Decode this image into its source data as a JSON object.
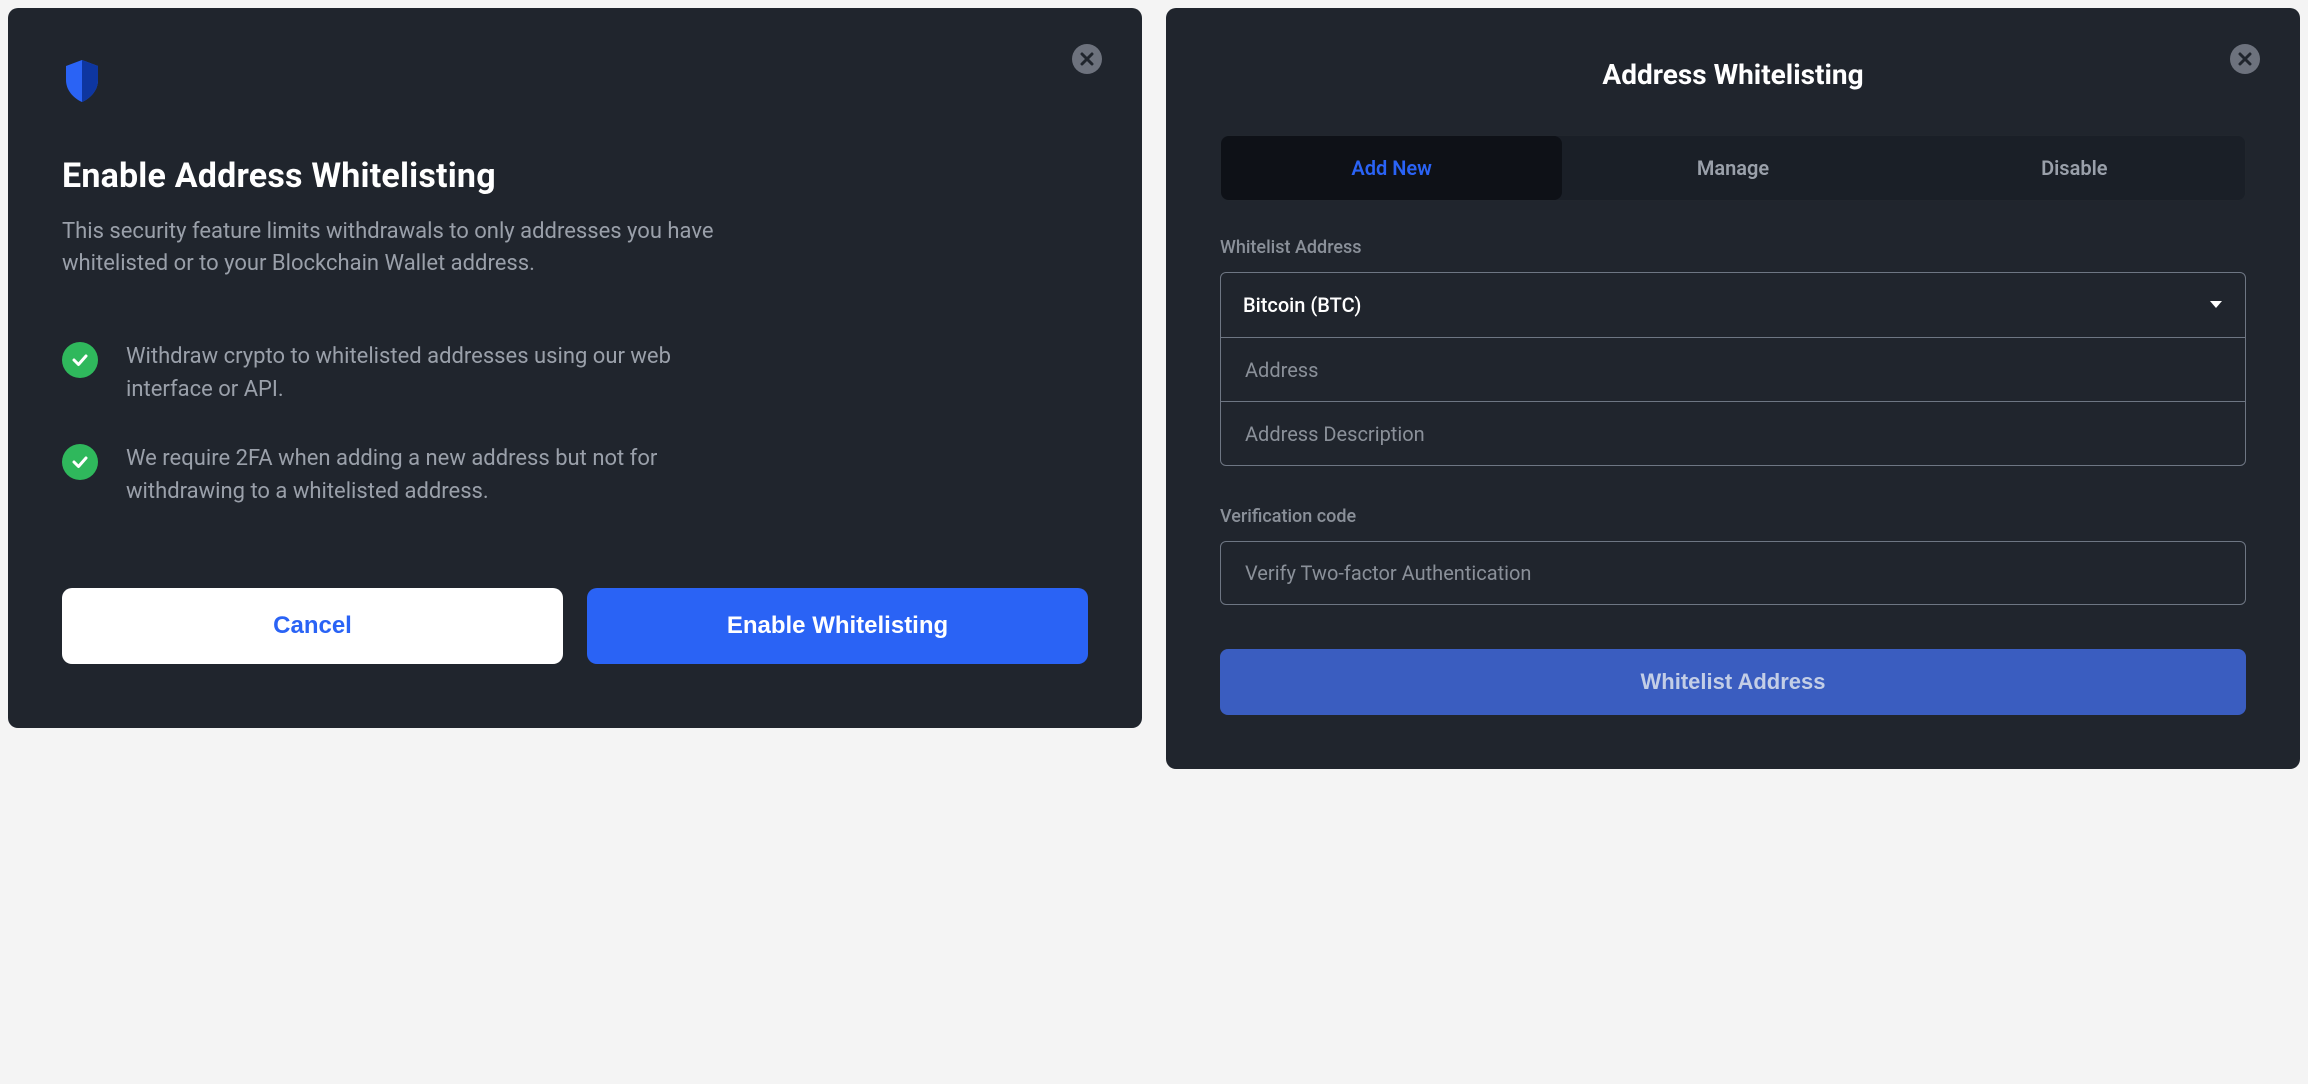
{
  "left_dialog": {
    "title": "Enable Address Whitelisting",
    "subtitle": "This security feature limits withdrawals to only addresses you have whitelisted or to your Blockchain Wallet address.",
    "bullets": [
      "Withdraw crypto to whitelisted addresses using our web interface or API.",
      "We require 2FA when adding a new address but not for withdrawing to a whitelisted address."
    ],
    "cancel_label": "Cancel",
    "enable_label": "Enable Whitelisting"
  },
  "right_dialog": {
    "title": "Address Whitelisting",
    "tabs": [
      {
        "label": "Add New",
        "active": true
      },
      {
        "label": "Manage",
        "active": false
      },
      {
        "label": "Disable",
        "active": false
      }
    ],
    "section_whitelist_label": "Whitelist Address",
    "currency_select_value": "Bitcoin (BTC)",
    "address_placeholder": "Address",
    "description_placeholder": "Address Description",
    "section_verification_label": "Verification code",
    "verification_placeholder": "Verify Two-factor Authentication",
    "submit_label": "Whitelist Address"
  },
  "colors": {
    "accent_blue": "#2a63f5",
    "success_green": "#2fb85c"
  }
}
